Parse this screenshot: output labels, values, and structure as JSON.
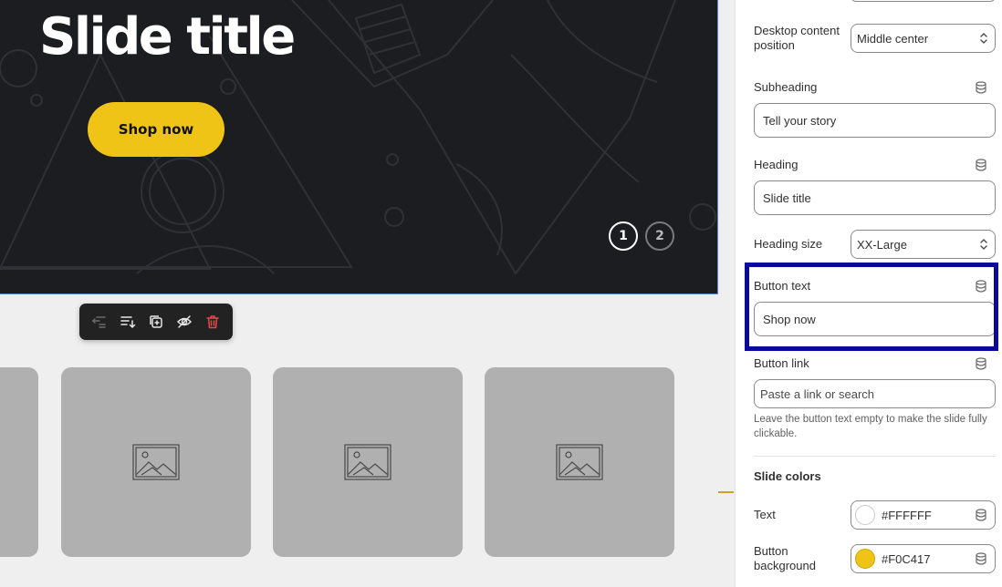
{
  "slide": {
    "title": "Slide title",
    "button_label": "Shop now",
    "button_color": "#F0C417",
    "background_color": "#1B1D20",
    "pagination": [
      "1",
      "2"
    ],
    "active_page": "1"
  },
  "block_toolbar": {
    "icons": [
      "move-to-parent-icon",
      "reorder-icon",
      "duplicate-icon",
      "hide-icon",
      "delete-icon"
    ]
  },
  "image_tiles": {
    "count": 4,
    "icon": "image-placeholder-icon"
  },
  "settings": {
    "desktop_content_position": {
      "label": "Desktop content position",
      "value": "Middle center"
    },
    "subheading": {
      "label": "Subheading",
      "value": "Tell your story"
    },
    "heading": {
      "label": "Heading",
      "value": "Slide title"
    },
    "heading_size": {
      "label": "Heading size",
      "value": "XX-Large"
    },
    "button_text": {
      "label": "Button text",
      "value": "Shop now"
    },
    "button_link": {
      "label": "Button link",
      "placeholder": "Paste a link or search",
      "help": "Leave the button text empty to make the slide fully clickable."
    },
    "slide_colors": {
      "title": "Slide colors",
      "text": {
        "label": "Text",
        "value": "#FFFFFF",
        "swatch": "#FFFFFF"
      },
      "button_background": {
        "label": "Button background",
        "value": "#F0C417",
        "swatch": "#F0C417"
      }
    }
  },
  "colors": {
    "highlight": "#0A0A9A",
    "selection": "#5B86E5",
    "delete": "#E5484D"
  }
}
